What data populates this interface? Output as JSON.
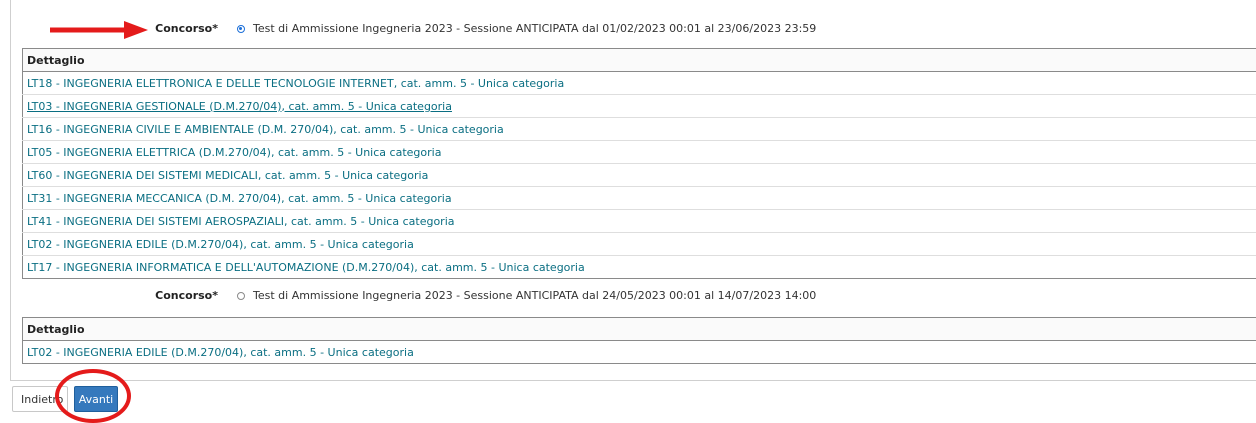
{
  "concorsi": [
    {
      "label": "Concorso*",
      "option_text": "Test di Ammissione Ingegneria 2023 - Sessione ANTICIPATA dal 01/02/2023 00:01 al 23/06/2023 23:59",
      "selected": true,
      "table_header": "Dettaglio",
      "rows": [
        "LT18 - INGEGNERIA ELETTRONICA E DELLE TECNOLOGIE INTERNET, cat. amm. 5 - Unica categoria",
        "LT03 - INGEGNERIA GESTIONALE (D.M.270/04), cat. amm. 5 - Unica categoria",
        "LT16 - INGEGNERIA CIVILE E AMBIENTALE (D.M. 270/04), cat. amm. 5 - Unica categoria",
        "LT05 - INGEGNERIA ELETTRICA (D.M.270/04), cat. amm. 5 - Unica categoria",
        "LT60 - INGEGNERIA DEI SISTEMI MEDICALI, cat. amm. 5 - Unica categoria",
        "LT31 - INGEGNERIA MECCANICA (D.M. 270/04), cat. amm. 5 - Unica categoria",
        "LT41 - INGEGNERIA DEI SISTEMI AEROSPAZIALI, cat. amm. 5 - Unica categoria",
        "LT02 - INGEGNERIA EDILE (D.M.270/04), cat. amm. 5 - Unica categoria",
        "LT17 - INGEGNERIA INFORMATICA E DELL'AUTOMAZIONE (D.M.270/04), cat. amm. 5 - Unica categoria"
      ]
    },
    {
      "label": "Concorso*",
      "option_text": "Test di Ammissione Ingegneria 2023 - Sessione ANTICIPATA dal 24/05/2023 00:01 al 14/07/2023 14:00",
      "selected": false,
      "table_header": "Dettaglio",
      "rows": [
        "LT02 - INGEGNERIA EDILE (D.M.270/04), cat. amm. 5 - Unica categoria"
      ]
    }
  ],
  "buttons": {
    "back": "Indietro",
    "next": "Avanti"
  },
  "colors": {
    "link": "#0a6e82",
    "radio_selected": "#1c6fd8",
    "primary_button": "#3579bd",
    "annotation": "#e41b1b"
  },
  "annotations": {
    "arrow": "red-arrow-icon",
    "circle": "red-circle-highlight"
  }
}
